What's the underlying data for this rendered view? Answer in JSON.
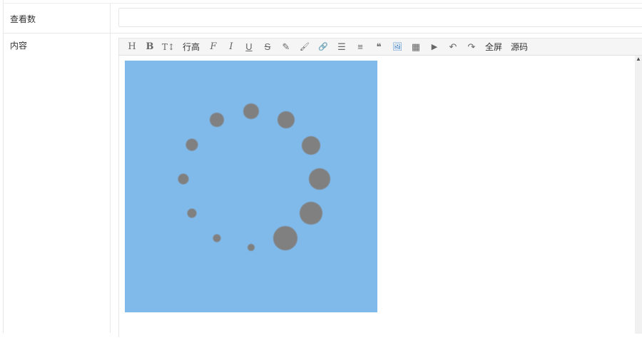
{
  "form": {
    "views_label": "查看数",
    "views_value": "",
    "content_label": "内容"
  },
  "toolbar": {
    "icons": {
      "heading": "H",
      "bold": "B",
      "font_size": "T↕",
      "font_family": "F",
      "italic": "I",
      "underline": "U",
      "strike": "S",
      "highlight": "✎",
      "brush": "🖌",
      "link": "🔗",
      "list": "☰",
      "align": "≡",
      "quote": "❝",
      "image": "🖼",
      "table": "▦",
      "video": "▶",
      "undo": "↶",
      "redo": "↷"
    },
    "line_height_label": "行高",
    "fullscreen_label": "全屏",
    "source_label": "源码"
  },
  "editor": {
    "image_colors": {
      "background": "#80baeb",
      "dots": "#808080"
    }
  }
}
